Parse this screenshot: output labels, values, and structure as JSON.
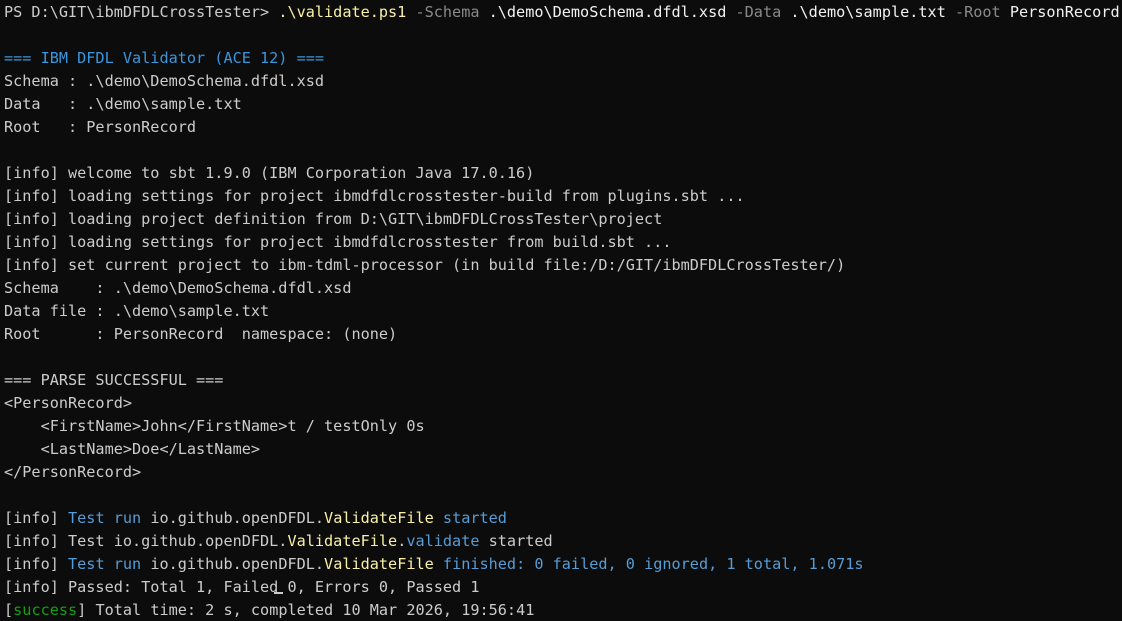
{
  "colors": {
    "background": "#0c0c0c",
    "default_text": "#cccccc",
    "command": "#f9f1a5",
    "parameter": "#8a8a8a",
    "header": "#3a96dd",
    "highlight": "#f9f1a5",
    "test_info": "#569cd6",
    "success": "#13a10e"
  },
  "lines": [
    {
      "segments": [
        {
          "text": "PS D:\\GIT\\ibmDFDLCrossTester> ",
          "color": "white"
        },
        {
          "text": ".\\validate.ps1",
          "color": "yellow"
        },
        {
          "text": " -Schema ",
          "color": "gray"
        },
        {
          "text": ".\\demo\\DemoSchema.dfdl.xsd",
          "color": "bright"
        },
        {
          "text": " -Data ",
          "color": "gray"
        },
        {
          "text": ".\\demo\\sample.txt",
          "color": "bright"
        },
        {
          "text": " -Root ",
          "color": "gray"
        },
        {
          "text": "PersonRecord",
          "color": "bright"
        }
      ]
    },
    {
      "segments": []
    },
    {
      "segments": [
        {
          "text": "=== IBM DFDL Validator (ACE 12) ===",
          "color": "cyan"
        }
      ]
    },
    {
      "segments": [
        {
          "text": "Schema : .\\demo\\DemoSchema.dfdl.xsd",
          "color": "white"
        }
      ]
    },
    {
      "segments": [
        {
          "text": "Data   : .\\demo\\sample.txt",
          "color": "white"
        }
      ]
    },
    {
      "segments": [
        {
          "text": "Root   : PersonRecord",
          "color": "white"
        }
      ]
    },
    {
      "segments": []
    },
    {
      "segments": [
        {
          "text": "[info] welcome to sbt 1.9.0 (IBM Corporation Java 17.0.16)",
          "color": "white"
        }
      ]
    },
    {
      "segments": [
        {
          "text": "[info] loading settings for project ibmdfdlcrosstester-build from plugins.sbt ...",
          "color": "white"
        }
      ]
    },
    {
      "segments": [
        {
          "text": "[info] loading project definition from D:\\GIT\\ibmDFDLCrossTester\\project",
          "color": "white"
        }
      ]
    },
    {
      "segments": [
        {
          "text": "[info] loading settings for project ibmdfdlcrosstester from build.sbt ...",
          "color": "white"
        }
      ]
    },
    {
      "segments": [
        {
          "text": "[info] set current project to ibm-tdml-processor (in build file:/D:/GIT/ibmDFDLCrossTester/)",
          "color": "white"
        }
      ]
    },
    {
      "segments": [
        {
          "text": "Schema    : .\\demo\\DemoSchema.dfdl.xsd",
          "color": "white"
        }
      ]
    },
    {
      "segments": [
        {
          "text": "Data file : .\\demo\\sample.txt",
          "color": "white"
        }
      ]
    },
    {
      "segments": [
        {
          "text": "Root      : PersonRecord  namespace: (none)",
          "color": "white"
        }
      ]
    },
    {
      "segments": []
    },
    {
      "segments": [
        {
          "text": "=== PARSE SUCCESSFUL ===",
          "color": "white"
        }
      ]
    },
    {
      "segments": [
        {
          "text": "<PersonRecord>",
          "color": "white"
        }
      ]
    },
    {
      "segments": [
        {
          "text": "    <FirstName>John</FirstName>t / testOnly 0s",
          "color": "white"
        }
      ]
    },
    {
      "segments": [
        {
          "text": "    <LastName>Doe</LastName>",
          "color": "white"
        }
      ]
    },
    {
      "segments": [
        {
          "text": "</PersonRecord>",
          "color": "white"
        }
      ]
    },
    {
      "segments": []
    },
    {
      "segments": [
        {
          "text": "[info] ",
          "color": "white"
        },
        {
          "text": "Test run ",
          "color": "blue"
        },
        {
          "text": "io.github.openDFDL.",
          "color": "white"
        },
        {
          "text": "ValidateFile",
          "color": "yellow"
        },
        {
          "text": " started",
          "color": "blue"
        }
      ]
    },
    {
      "segments": [
        {
          "text": "[info] Test io.github.openDFDL.",
          "color": "white"
        },
        {
          "text": "ValidateFile",
          "color": "yellow"
        },
        {
          "text": ".",
          "color": "white"
        },
        {
          "text": "validate",
          "color": "blue"
        },
        {
          "text": " started",
          "color": "white"
        }
      ]
    },
    {
      "segments": [
        {
          "text": "[info] ",
          "color": "white"
        },
        {
          "text": "Test run ",
          "color": "blue"
        },
        {
          "text": "io.github.openDFDL.",
          "color": "white"
        },
        {
          "text": "ValidateFile",
          "color": "yellow"
        },
        {
          "text": " finished: 0 failed, 0 ignored, 1 total, 1.071s",
          "color": "blue"
        }
      ]
    },
    {
      "segments": [
        {
          "text": "[info] Passed: Total 1, Failed 0, Errors 0, Passed 1",
          "color": "white"
        }
      ]
    },
    {
      "segments": [
        {
          "text": "[",
          "color": "white"
        },
        {
          "text": "success",
          "color": "green"
        },
        {
          "text": "] Total time: 2 s, completed 10 Mar 2026, 19:56:41",
          "color": "white"
        }
      ]
    }
  ]
}
